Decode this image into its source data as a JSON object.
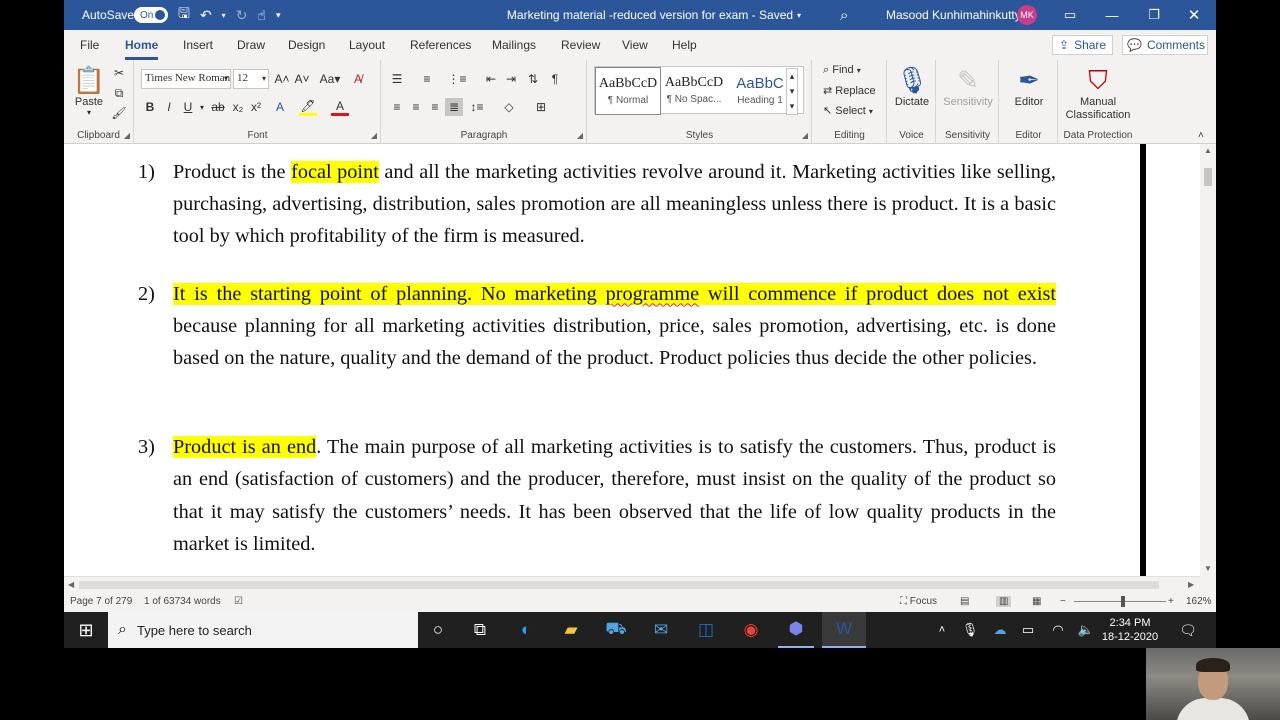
{
  "titlebar": {
    "autosave_label": "AutoSave",
    "autosave_state": "On",
    "doc_title": "Marketing material -reduced version for exam  -  Saved",
    "user_name": "Masood Kunhimahinkutty",
    "user_initials": "MK"
  },
  "tabs": [
    "File",
    "Home",
    "Insert",
    "Draw",
    "Design",
    "Layout",
    "References",
    "Mailings",
    "Review",
    "View",
    "Help"
  ],
  "active_tab": "Home",
  "share_label": "Share",
  "comments_label": "Comments",
  "ribbon": {
    "clipboard": {
      "paste_label": "Paste",
      "group_label": "Clipboard"
    },
    "font": {
      "font_name": "Times New Roman",
      "font_size": "12",
      "group_label": "Font"
    },
    "paragraph": {
      "group_label": "Paragraph"
    },
    "styles": {
      "group_label": "Styles",
      "items": [
        {
          "sample": "AaBbCcD",
          "name": "¶ Normal"
        },
        {
          "sample": "AaBbCcD",
          "name": "¶ No Spac..."
        },
        {
          "sample": "AaBbC",
          "name": "Heading 1"
        }
      ]
    },
    "editing": {
      "find": "Find",
      "replace": "Replace",
      "select": "Select",
      "group_label": "Editing"
    },
    "voice": {
      "dictate": "Dictate",
      "group_label": "Voice"
    },
    "sensitivity": {
      "label": "Sensitivity",
      "group_label": "Sensitivity"
    },
    "editor": {
      "label": "Editor",
      "group_label": "Editor"
    },
    "data_protection": {
      "label_line1": "Manual",
      "label_line2": "Classification",
      "group_label": "Data Protection"
    }
  },
  "document": {
    "p1": {
      "num": "1)",
      "a": "Product is the ",
      "hl": "focal point",
      "b": " and all the marketing activities revolve around it. Marketing activities like selling, purchasing, advertising, distribution, sales promotion are all meaningless unless there is product. It is a basic tool by which profitability of the firm is measured."
    },
    "p2": {
      "num": "2)",
      "hl_a": "It is the starting point of planning. No marketing ",
      "hl_misspelled": "programme",
      "hl_b": " will commence if product does not exist",
      "rest": " because planning for all marketing activities distribution, price, sales promotion, advertising, etc. is done based on the nature, quality and the demand of the product. Product policies thus decide the other policies."
    },
    "p3": {
      "num": "3)",
      "hl": "Product is an end",
      "rest": ". The main purpose of all marketing activities is to satisfy the customers. Thus, product is an end (satisfaction of customers) and the producer, therefore, must insist on the quality of the product so that it may satisfy the customers’ needs. It has been observed that the life of low quality products in the market is limited."
    }
  },
  "status": {
    "page": "Page 7 of 279",
    "words": "1 of 63734 words",
    "focus": "Focus",
    "zoom": "162%"
  },
  "taskbar": {
    "search_placeholder": "Type here to search",
    "time": "2:34 PM",
    "date": "18-12-2020"
  },
  "colors": {
    "word_blue": "#2b579a",
    "highlight": "#ffff00",
    "taskbar": "#202020"
  }
}
